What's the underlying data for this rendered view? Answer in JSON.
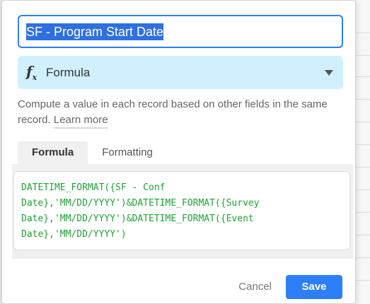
{
  "field": {
    "name": "SF - Program Start Date",
    "type_label": "Formula",
    "type_icon": "function-fx-icon"
  },
  "description": {
    "text": "Compute a value in each record based on other fields in the same record.",
    "learn_more": "Learn more"
  },
  "tabs": [
    {
      "label": "Formula",
      "active": true
    },
    {
      "label": "Formatting",
      "active": false
    }
  ],
  "formula": {
    "lines": [
      "DATETIME_FORMAT({SF - Conf",
      "Date},'MM/DD/YYYY')&DATETIME_FORMAT({Survey",
      "Date},'MM/DD/YYYY')&DATETIME_FORMAT({Event",
      "Date},'MM/DD/YYYY')"
    ]
  },
  "footer": {
    "cancel_label": "Cancel",
    "save_label": "Save"
  },
  "colors": {
    "accent": "#2d7ff9",
    "type_bg": "#d0f0fd",
    "formula_text": "#20a336"
  }
}
